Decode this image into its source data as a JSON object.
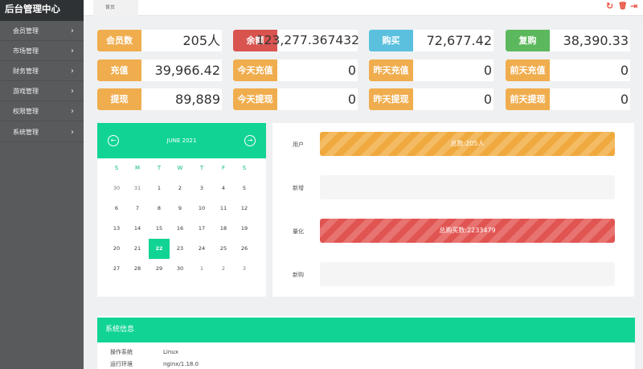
{
  "sidebar": {
    "brand": "后台管理中心",
    "items": [
      {
        "label": "会员管理"
      },
      {
        "label": "市场管理"
      },
      {
        "label": "财务管理"
      },
      {
        "label": "游戏管理"
      },
      {
        "label": "权限管理"
      },
      {
        "label": "系统管理"
      }
    ]
  },
  "topbar": {
    "tab": "首页",
    "tools": {
      "refresh": "↻",
      "delete": "🗑",
      "logout": "⇥"
    }
  },
  "stats": [
    {
      "label": "会员数",
      "value": "205人",
      "color": "#f0ad4e"
    },
    {
      "label": "余额",
      "value": "123,277.367432",
      "color": "#d9534f"
    },
    {
      "label": "购买",
      "value": "72,677.42",
      "color": "#5bc0de"
    },
    {
      "label": "复购",
      "value": "38,390.33",
      "color": "#5cb85c"
    },
    {
      "label": "充值",
      "value": "39,966.42",
      "color": "#f0ad4e"
    },
    {
      "label": "今天充值",
      "value": "0",
      "color": "#f0ad4e"
    },
    {
      "label": "昨天充值",
      "value": "0",
      "color": "#f0ad4e"
    },
    {
      "label": "前天充值",
      "value": "0",
      "color": "#f0ad4e"
    },
    {
      "label": "提现",
      "value": "89,889",
      "color": "#f0ad4e"
    },
    {
      "label": "今天提现",
      "value": "0",
      "color": "#f0ad4e"
    },
    {
      "label": "昨天提现",
      "value": "0",
      "color": "#f0ad4e"
    },
    {
      "label": "前天提现",
      "value": "0",
      "color": "#f0ad4e"
    }
  ],
  "calendar": {
    "title": "JUNE 2021",
    "prev": "←",
    "next": "→",
    "weekdays": [
      "S",
      "M",
      "T",
      "W",
      "T",
      "F",
      "S"
    ],
    "weeks": [
      [
        "30",
        "31",
        "1",
        "2",
        "3",
        "4",
        "5"
      ],
      [
        "6",
        "7",
        "8",
        "9",
        "10",
        "11",
        "12"
      ],
      [
        "13",
        "14",
        "15",
        "16",
        "17",
        "18",
        "19"
      ],
      [
        "20",
        "21",
        "22",
        "23",
        "24",
        "25",
        "26"
      ],
      [
        "27",
        "28",
        "29",
        "30",
        "1",
        "2",
        "3"
      ]
    ],
    "today": "22"
  },
  "progress": [
    {
      "label": "用户",
      "text": "总数:205人",
      "fill": 1.0,
      "style": "orange"
    },
    {
      "label": "新增",
      "text": "",
      "fill": 0,
      "style": "orange"
    },
    {
      "label": "量化",
      "text": "总购买数:2233479",
      "fill": 1.0,
      "style": "red"
    },
    {
      "label": "新购",
      "text": "",
      "fill": 0,
      "style": "red"
    }
  ],
  "system": {
    "title": "系统信息",
    "rows": [
      {
        "key": "操作系统",
        "value": "Linux"
      },
      {
        "key": "运行环境",
        "value": "nginx/1.18.0"
      }
    ]
  }
}
